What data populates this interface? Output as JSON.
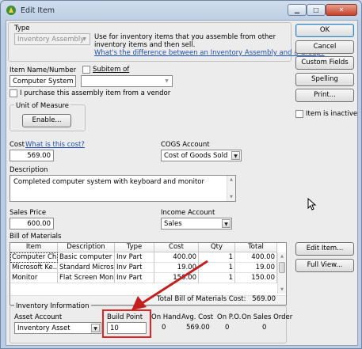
{
  "window": {
    "title": "Edit Item",
    "controls": {
      "minimize": "▁",
      "maximize": "□",
      "close": "✕"
    }
  },
  "type_section": {
    "label": "Type",
    "value": "Inventory Assembly",
    "description": "Use for inventory items that you assemble from other inventory items and then sell.",
    "link": "What's the difference between an Inventory Assembly and a Group?"
  },
  "buttons": {
    "ok": "OK",
    "cancel": "Cancel",
    "custom_fields": "Custom Fields",
    "spelling": "Spelling",
    "print": "Print...",
    "enable": "Enable...",
    "edit_item": "Edit Item...",
    "full_view": "Full View..."
  },
  "item": {
    "name_label": "Item Name/Number",
    "name_value": "Computer System",
    "subitem_label": "Subitem of",
    "subitem_value": "",
    "purchase_vendor_label": "I purchase this assembly item from a vendor",
    "inactive_label": "Item is inactive"
  },
  "unit_of_measure": {
    "label": "Unit of Measure"
  },
  "cost": {
    "label": "Cost",
    "link": "What is this cost?",
    "value": "569.00"
  },
  "cogs": {
    "label": "COGS Account",
    "value": "Cost of Goods Sold"
  },
  "description": {
    "label": "Description",
    "value": "Completed computer system with keyboard and monitor"
  },
  "sales_price": {
    "label": "Sales Price",
    "value": "600.00"
  },
  "income_account": {
    "label": "Income Account",
    "value": "Sales"
  },
  "bom": {
    "label": "Bill of Materials",
    "columns": [
      "Item",
      "Description",
      "Type",
      "Cost",
      "Qty",
      "Total"
    ],
    "rows": [
      {
        "item": "Computer Ch...",
        "description": "Basic computer ...",
        "type": "Inv Part",
        "cost": "400.00",
        "qty": "1",
        "total": "400.00"
      },
      {
        "item": "Microsoft Ke...",
        "description": "Standard Micros...",
        "type": "Inv Part",
        "cost": "19.00",
        "qty": "1",
        "total": "19.00"
      },
      {
        "item": "Monitor",
        "description": "Flat Screen Moni...",
        "type": "Inv Part",
        "cost": "150.00",
        "qty": "1",
        "total": "150.00"
      }
    ],
    "total_label": "Total Bill of Materials Cost:",
    "total_value": "569.00"
  },
  "inventory": {
    "section_label": "Inventory Information",
    "asset_account_label": "Asset Account",
    "asset_account_value": "Inventory Asset",
    "build_point_label": "Build Point",
    "build_point_value": "10",
    "on_hand_label": "On Hand",
    "on_hand_value": "0",
    "avg_cost_label": "Avg. Cost",
    "avg_cost_value": "569.00",
    "on_po_label": "On P.O.",
    "on_po_value": "0",
    "on_sales_order_label": "On Sales Order",
    "on_sales_order_value": "0"
  },
  "colors": {
    "highlight": "#e32424",
    "arrow": "#c41f1f",
    "link": "#1f4fb3"
  }
}
